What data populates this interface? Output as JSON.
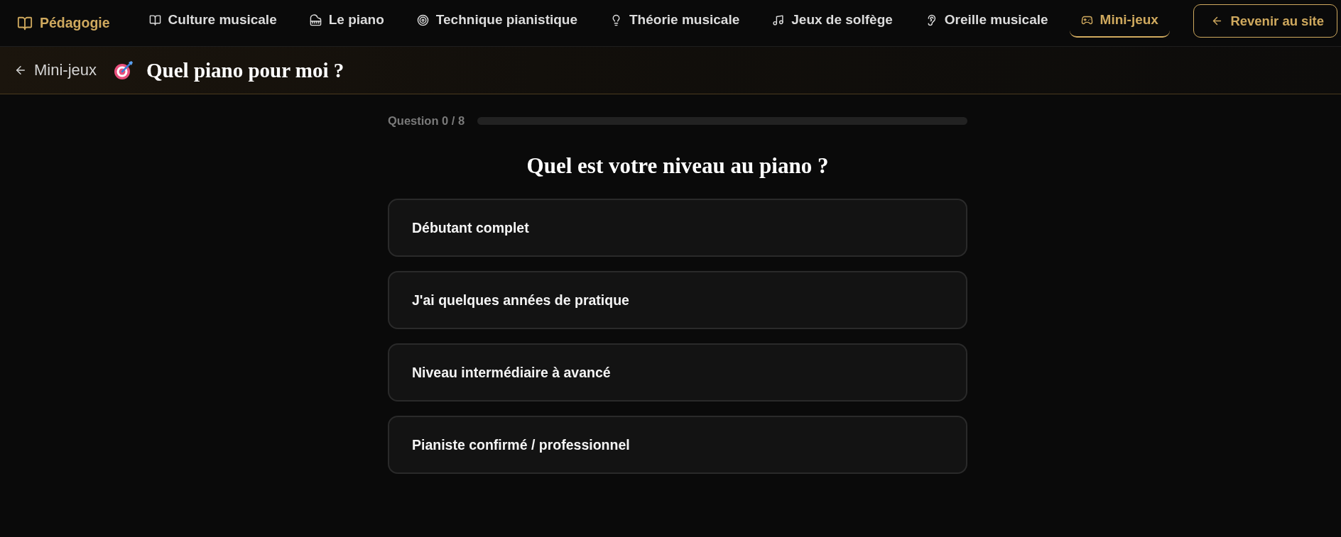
{
  "nav": {
    "brand": "Pédagogie",
    "items": [
      {
        "label": "Culture musicale",
        "selected": false
      },
      {
        "label": "Le piano",
        "selected": false
      },
      {
        "label": "Technique pianistique",
        "selected": false
      },
      {
        "label": "Théorie musicale",
        "selected": false
      },
      {
        "label": "Jeux de solfège",
        "selected": false
      },
      {
        "label": "Oreille musicale",
        "selected": false
      },
      {
        "label": "Mini-jeux",
        "selected": true
      }
    ],
    "back_to_site": "Revenir au site"
  },
  "header": {
    "back_link": "Mini-jeux",
    "title": "Quel piano pour moi ?"
  },
  "quiz": {
    "progress_label": "Question 0 / 8",
    "progress": {
      "level": 0
    },
    "question": "Quel est votre niveau au piano ?",
    "options": [
      {
        "label": "Débutant complet",
        "selected": false
      },
      {
        "label": "J'ai quelques années de pratique",
        "selected": false
      },
      {
        "label": "Niveau intermédiaire à avancé",
        "selected": false
      },
      {
        "label": "Pianiste confirmé / professionnel",
        "selected": false
      }
    ]
  }
}
